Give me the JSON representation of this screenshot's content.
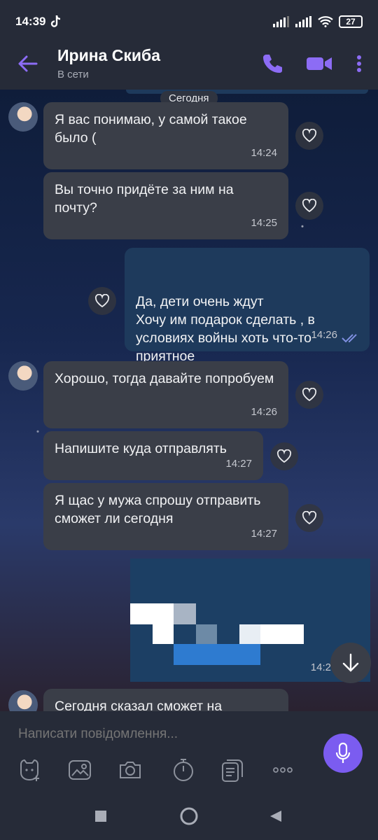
{
  "status_bar": {
    "time": "14:39",
    "battery": "27"
  },
  "header": {
    "contact_name": "Ирина Скиба",
    "contact_status": "В сети"
  },
  "chat": {
    "date_label": "Сегодня",
    "messages": [
      {
        "direction": "in",
        "text": "Я вас понимаю, у самой такое было (",
        "time": "14:24"
      },
      {
        "direction": "in",
        "text": "Вы точно придёте за ним на почту?",
        "time": "14:25"
      },
      {
        "direction": "out",
        "text": "Да, дети очень ждут\nХочу им подарок сделать , в условиях войны хоть что-то приятное",
        "time": "14:26"
      },
      {
        "direction": "in",
        "text": "Хорошо, тогда давайте попробуем",
        "time": "14:26"
      },
      {
        "direction": "in",
        "text": "Напишите куда отправлять",
        "time": "14:27"
      },
      {
        "direction": "in",
        "text": "Я щас у мужа спрошу отправить сможет ли сегодня",
        "time": "14:27"
      },
      {
        "direction": "out",
        "text": "",
        "time": "14:2"
      },
      {
        "direction": "in",
        "text": "Сегодня сказал сможет на",
        "time": ""
      }
    ]
  },
  "composer": {
    "placeholder": "Написати повідомлення..."
  },
  "colors": {
    "accent": "#7b5cf0",
    "incoming_bubble": "#3a3e48",
    "outgoing_bubble": "#1e3a5c"
  }
}
